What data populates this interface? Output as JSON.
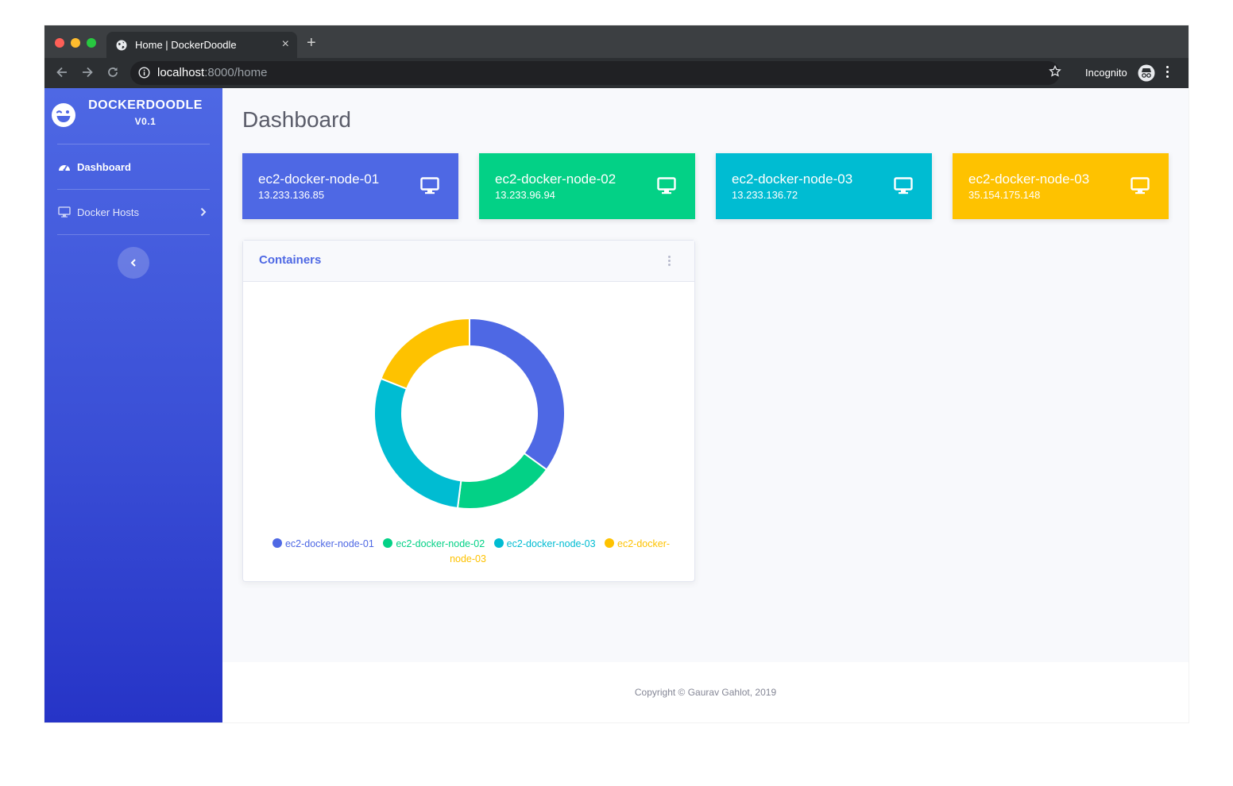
{
  "browser": {
    "tab_title": "Home | DockerDoodle",
    "url_host": "localhost",
    "url_rest": ":8000/home",
    "mode_label": "Incognito"
  },
  "sidebar": {
    "brand_name": "DOCKERDOODLE",
    "brand_version": "V0.1",
    "items": [
      {
        "label": "Dashboard",
        "icon": "tachometer-icon",
        "active": true
      },
      {
        "label": "Docker Hosts",
        "icon": "desktop-icon",
        "active": false
      }
    ]
  },
  "page": {
    "title": "Dashboard",
    "nodes": [
      {
        "name": "ec2-docker-node-01",
        "ip": "13.233.136.85",
        "color": "#4e68e4"
      },
      {
        "name": "ec2-docker-node-02",
        "ip": "13.233.96.94",
        "color": "#03d186"
      },
      {
        "name": "ec2-docker-node-03",
        "ip": "13.233.136.72",
        "color": "#00bcd2"
      },
      {
        "name": "ec2-docker-node-03",
        "ip": "35.154.175.148",
        "color": "#fec200"
      }
    ]
  },
  "containers_panel": {
    "title": "Containers"
  },
  "chart_data": {
    "type": "pie",
    "title": "Containers",
    "categories": [
      "ec2-docker-node-01",
      "ec2-docker-node-02",
      "ec2-docker-node-03",
      "ec2-docker-node-03"
    ],
    "values": [
      35,
      17,
      29,
      19
    ],
    "colors": [
      "#4e68e4",
      "#03d186",
      "#00bcd2",
      "#fec200"
    ],
    "donut": true,
    "legend": "bottom"
  },
  "footer": {
    "copyright": "Copyright © Gaurav Gahlot, 2019"
  }
}
